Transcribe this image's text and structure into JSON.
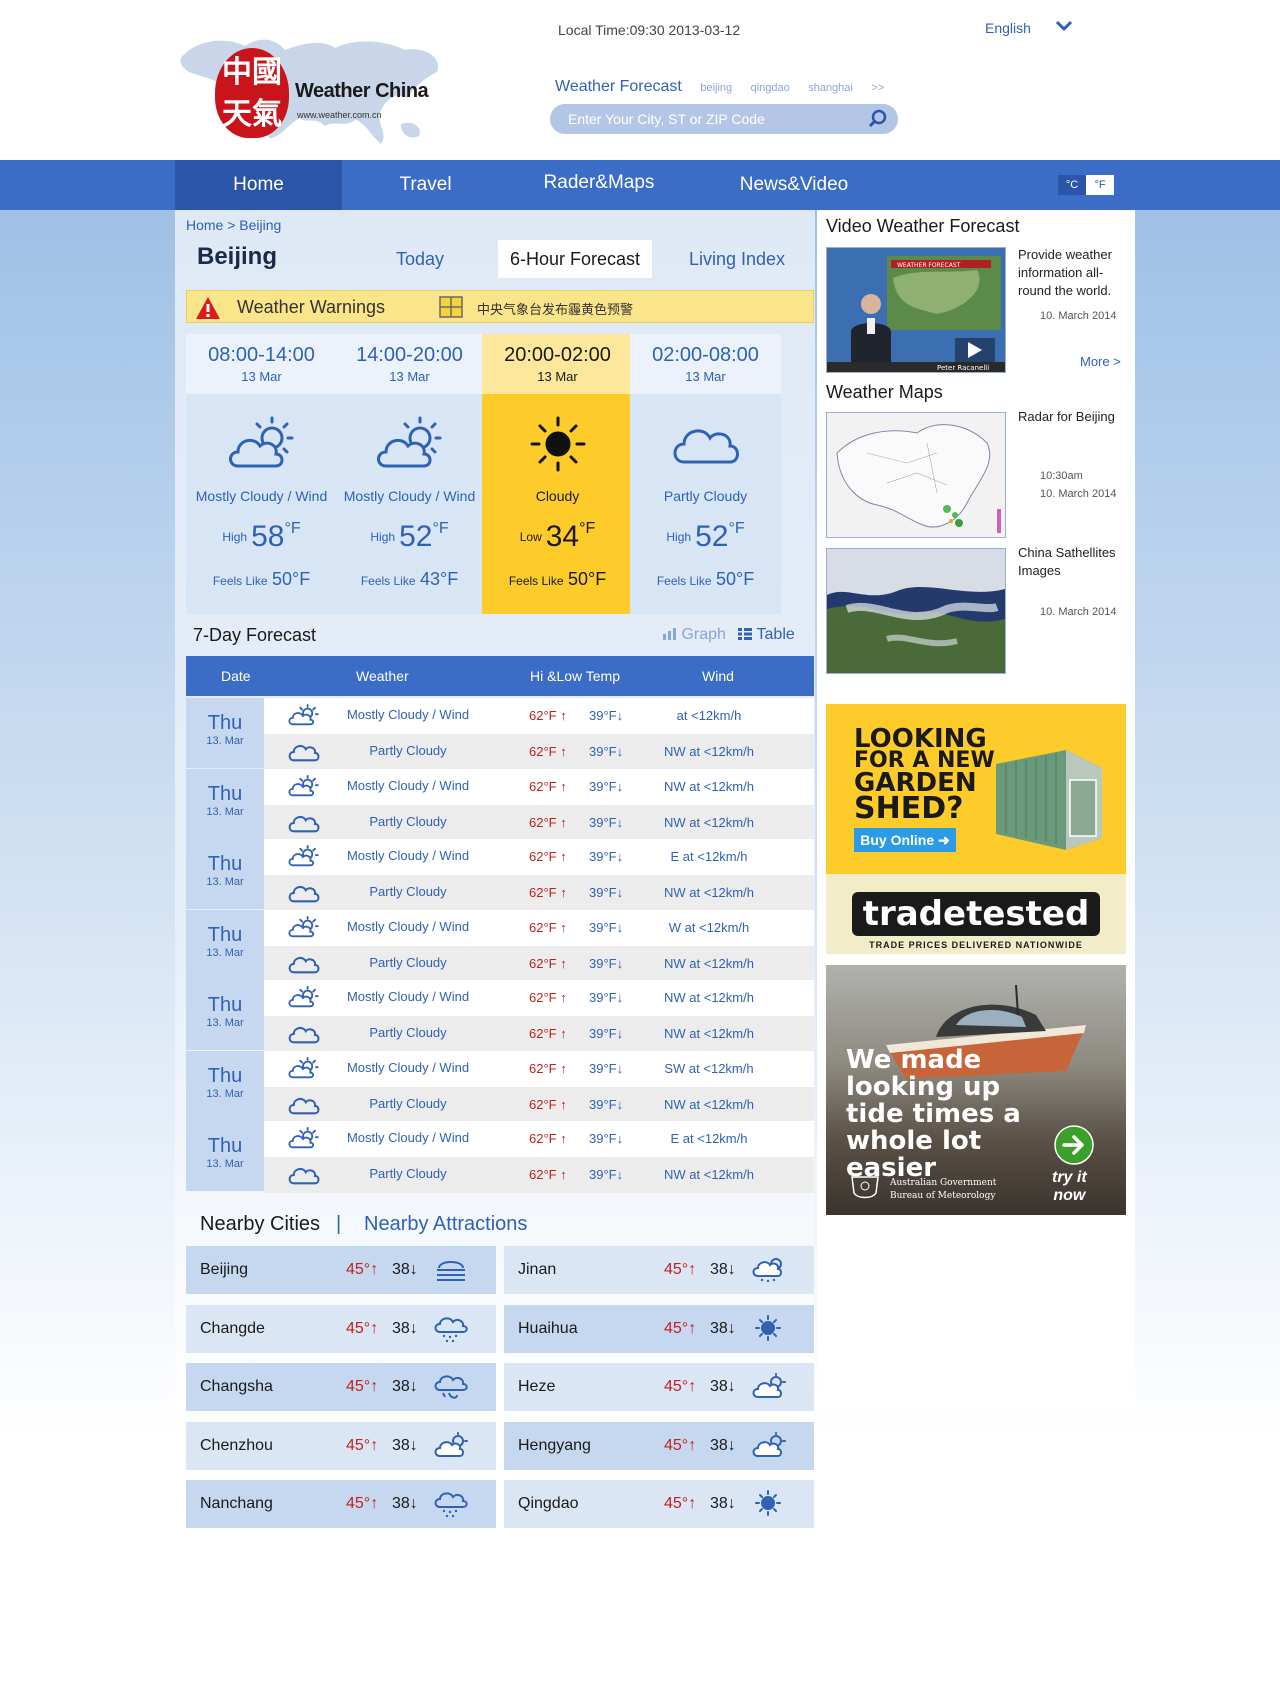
{
  "header": {
    "brand_name": "Weather China",
    "brand_url": "www.weather.com.cn",
    "seal_text": "中國天氣",
    "local_time": "Local Time:09:30  2013-03-12",
    "language": "English",
    "forecast_label": "Weather Forecast",
    "quick_cities": [
      "beijing",
      "qingdao",
      "shanghai",
      ">>"
    ],
    "search_placeholder": "Enter Your City, ST or ZIP Code"
  },
  "nav": {
    "items": [
      "Home",
      "Travel",
      "Rader&Maps",
      "News&Video"
    ],
    "active": "Home",
    "units": [
      "°C",
      "°F"
    ]
  },
  "page": {
    "breadcrumb": "Home > Beijing",
    "city": "Beijing",
    "tabs": [
      "Today",
      "6-Hour Forecast",
      "Living Index"
    ],
    "active_tab": "6-Hour Forecast"
  },
  "warning": {
    "title": "Weather Warnings",
    "text": "中央气象台发布霾黄色预警"
  },
  "six_hour": [
    {
      "time": "08:00-14:00",
      "date": "13 Mar",
      "icon": "mostly-cloudy-icon",
      "condition": "Mostly Cloudy / Wind",
      "temp_label": "High",
      "temp": "58",
      "unit": "°F",
      "feels_label": "Feels Like",
      "feels": "50°F"
    },
    {
      "time": "14:00-20:00",
      "date": "13 Mar",
      "icon": "mostly-cloudy-icon",
      "condition": "Mostly Cloudy / Wind",
      "temp_label": "High",
      "temp": "52",
      "unit": "°F",
      "feels_label": "Feels Like",
      "feels": "43°F"
    },
    {
      "time": "20:00-02:00",
      "date": "13 Mar",
      "icon": "sun-icon",
      "condition": "Cloudy",
      "temp_label": "Low",
      "temp": "34",
      "unit": "°F",
      "feels_label": "Feels Like",
      "feels": "50°F"
    },
    {
      "time": "02:00-08:00",
      "date": "13 Mar",
      "icon": "cloud-icon",
      "condition": "Partly Cloudy",
      "temp_label": "High",
      "temp": "52",
      "unit": "°F",
      "feels_label": "Feels Like",
      "feels": "50°F"
    }
  ],
  "seven_day": {
    "title": "7-Day  Forecast",
    "graph_label": "Graph",
    "table_label": "Table",
    "columns": [
      "Date",
      "Weather",
      "Hi &Low Temp",
      "Wind"
    ],
    "days": [
      {
        "day": "Thu",
        "date": "13. Mar",
        "rows": [
          {
            "weather": "Mostly Cloudy / Wind",
            "hi": "62°F ↑",
            "lo": "39°F↓",
            "wind": "at <12km/h"
          },
          {
            "weather": "Partly Cloudy",
            "hi": "62°F ↑",
            "lo": "39°F↓",
            "wind": "NW  at <12km/h"
          }
        ]
      },
      {
        "day": "Thu",
        "date": "13. Mar",
        "rows": [
          {
            "weather": "Mostly Cloudy / Wind",
            "hi": "62°F ↑",
            "lo": "39°F↓",
            "wind": "NW  at <12km/h"
          },
          {
            "weather": "Partly Cloudy",
            "hi": "62°F ↑",
            "lo": "39°F↓",
            "wind": "NW  at <12km/h"
          }
        ]
      },
      {
        "day": "Thu",
        "date": "13. Mar",
        "rows": [
          {
            "weather": "Mostly Cloudy / Wind",
            "hi": "62°F ↑",
            "lo": "39°F↓",
            "wind": "E  at <12km/h"
          },
          {
            "weather": "Partly Cloudy",
            "hi": "62°F ↑",
            "lo": "39°F↓",
            "wind": "NW  at <12km/h"
          }
        ]
      },
      {
        "day": "Thu",
        "date": "13. Mar",
        "rows": [
          {
            "weather": "Mostly Cloudy / Wind",
            "hi": "62°F ↑",
            "lo": "39°F↓",
            "wind": "W  at <12km/h"
          },
          {
            "weather": "Partly Cloudy",
            "hi": "62°F ↑",
            "lo": "39°F↓",
            "wind": "NW  at <12km/h"
          }
        ]
      },
      {
        "day": "Thu",
        "date": "13. Mar",
        "rows": [
          {
            "weather": "Mostly Cloudy / Wind",
            "hi": "62°F ↑",
            "lo": "39°F↓",
            "wind": "NW  at <12km/h"
          },
          {
            "weather": "Partly Cloudy",
            "hi": "62°F ↑",
            "lo": "39°F↓",
            "wind": "NW  at <12km/h"
          }
        ]
      },
      {
        "day": "Thu",
        "date": "13. Mar",
        "rows": [
          {
            "weather": "Mostly Cloudy / Wind",
            "hi": "62°F ↑",
            "lo": "39°F↓",
            "wind": "SW  at <12km/h"
          },
          {
            "weather": "Partly Cloudy",
            "hi": "62°F ↑",
            "lo": "39°F↓",
            "wind": "NW  at <12km/h"
          }
        ]
      },
      {
        "day": "Thu",
        "date": "13. Mar",
        "rows": [
          {
            "weather": "Mostly Cloudy / Wind",
            "hi": "62°F ↑",
            "lo": "39°F↓",
            "wind": "E  at <12km/h"
          },
          {
            "weather": "Partly Cloudy",
            "hi": "62°F ↑",
            "lo": "39°F↓",
            "wind": "NW  at <12km/h"
          }
        ]
      }
    ]
  },
  "nearby": {
    "title": "Nearby Cities",
    "separator": "|",
    "attractions": "Nearby Attractions",
    "cities": [
      {
        "name": "Beijing",
        "hi": "45°↑",
        "lo": "38↓",
        "icon": "fog-icon"
      },
      {
        "name": "Jinan",
        "hi": "45°↑",
        "lo": "38↓",
        "icon": "sun-cloud-rain-icon"
      },
      {
        "name": "Changde",
        "hi": "45°↑",
        "lo": "38↓",
        "icon": "rain-cloud-icon"
      },
      {
        "name": "Huaihua",
        "hi": "45°↑",
        "lo": "38↓",
        "icon": "sun-icon"
      },
      {
        "name": "Changsha",
        "hi": "45°↑",
        "lo": "38↓",
        "icon": "wind-cloud-icon"
      },
      {
        "name": "Heze",
        "hi": "45°↑",
        "lo": "38↓",
        "icon": "sun-cloud-icon"
      },
      {
        "name": "Chenzhou",
        "hi": "45°↑",
        "lo": "38↓",
        "icon": "sun-cloud-icon"
      },
      {
        "name": "Hengyang",
        "hi": "45°↑",
        "lo": "38↓",
        "icon": "sun-cloud-icon"
      },
      {
        "name": "Nanchang",
        "hi": "45°↑",
        "lo": "38↓",
        "icon": "rain-cloud-icon"
      },
      {
        "name": "Qingdao",
        "hi": "45°↑",
        "lo": "38↓",
        "icon": "sun-icon"
      }
    ]
  },
  "sidebar": {
    "video_title": "Video Weather Forecast",
    "video_desc": "Provide weather information all-round the world.",
    "video_date": "10. March 2014",
    "video_overlay": "WEATHER FORECAST",
    "video_presenter": "Peter Racanelli",
    "more": "More >",
    "maps_title": "Weather Maps",
    "radar_desc": "Radar for Beijing",
    "radar_time": "10:30am",
    "radar_date": "10. March 2014",
    "sat_desc": "China Sathellites Images",
    "sat_date": "10. March 2014"
  },
  "ads": {
    "shed_headline": [
      "LOOKING",
      "FOR A NEW",
      "GARDEN",
      "SHED?"
    ],
    "shed_button": "Buy Online ➜",
    "shed_brand": "tradetested",
    "shed_tag": "TRADE PRICES DELIVERED NATIONWIDE",
    "tide_message": "We made looking up tide times a whole lot easier",
    "tide_gov": [
      "Australian Government",
      "Bureau of Meteorology"
    ],
    "tide_cta": [
      "try it",
      "now"
    ]
  },
  "colors": {
    "primary": "#3b6dc6",
    "primary_dark": "#2a55a8",
    "highlight": "#fdcc2a",
    "warning_bg": "#fbe58a",
    "temp_high": "#c22020"
  }
}
